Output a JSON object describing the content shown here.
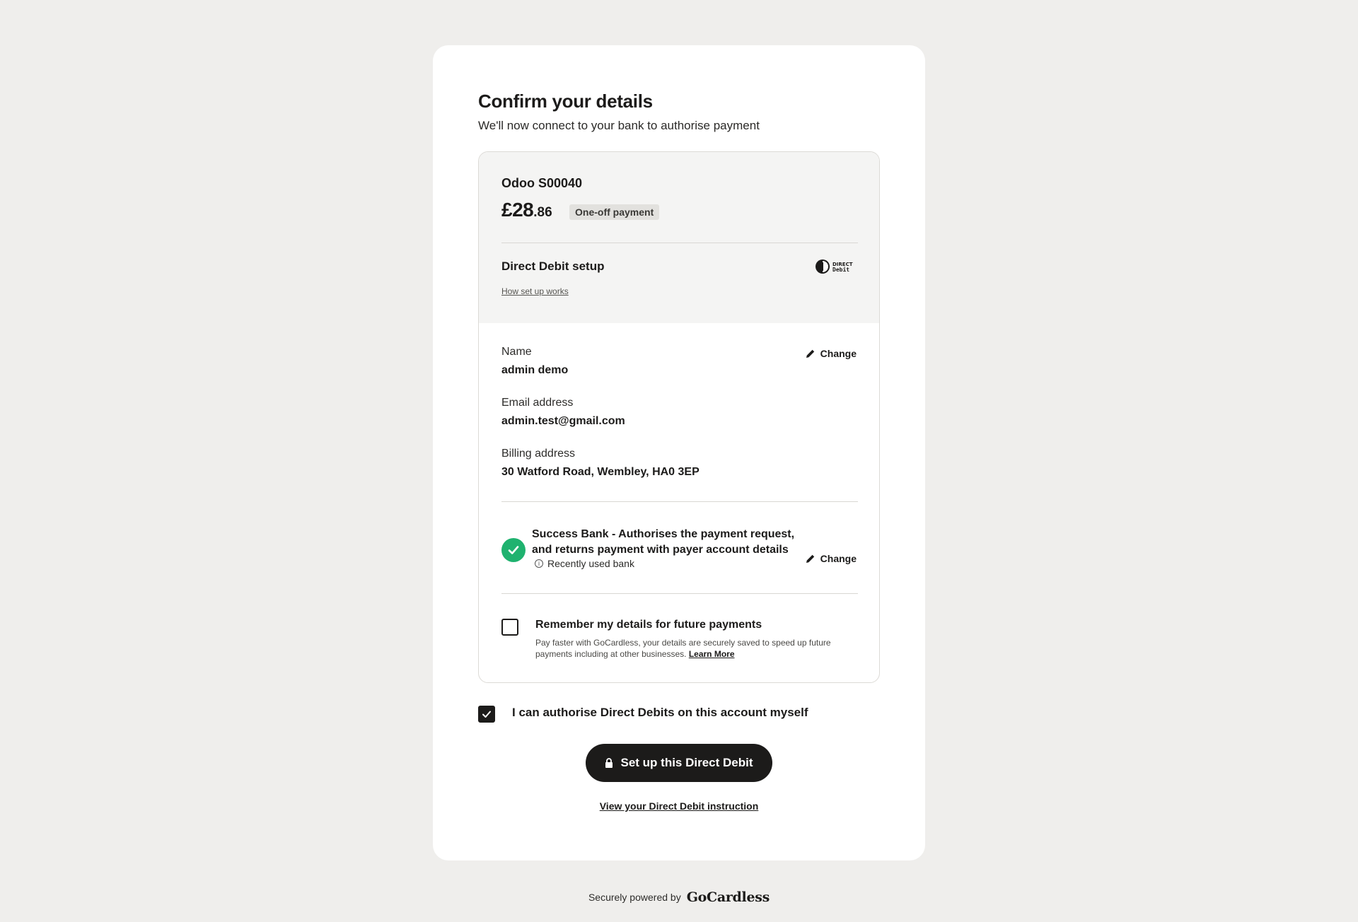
{
  "header": {
    "title": "Confirm your details",
    "subtitle": "We'll now connect to your bank to authorise payment"
  },
  "payment": {
    "merchant": "Odoo S00040",
    "amount_major": "£28",
    "amount_minor": ".86",
    "badge": "One-off payment"
  },
  "direct_debit": {
    "label": "Direct Debit setup",
    "how_link": "How set up works",
    "logo_text": "Direct Debit"
  },
  "details": {
    "change_label": "Change",
    "name_label": "Name",
    "name_value": "admin demo",
    "email_label": "Email address",
    "email_value": "admin.test@gmail.com",
    "billing_label": "Billing address",
    "billing_value": "30 Watford Road, Wembley, HA0 3EP"
  },
  "bank": {
    "name": "Success Bank - Authorises the payment request, and returns payment with payer account details",
    "recent": "Recently used bank",
    "change_label": "Change",
    "check_color": "#1fb26f"
  },
  "remember": {
    "checked": false,
    "title": "Remember my details for future payments",
    "description": "Pay faster with GoCardless, your details are securely saved to speed up future payments including at other businesses.",
    "learn_more": "Learn More"
  },
  "authorise": {
    "checked": true,
    "label": "I can authorise Direct Debits on this account myself"
  },
  "actions": {
    "setup_button": "Set up this Direct Debit",
    "view_instruction": "View your Direct Debit instruction"
  },
  "footer": {
    "powered_by": "Securely powered by",
    "brand": "GoCardless"
  }
}
